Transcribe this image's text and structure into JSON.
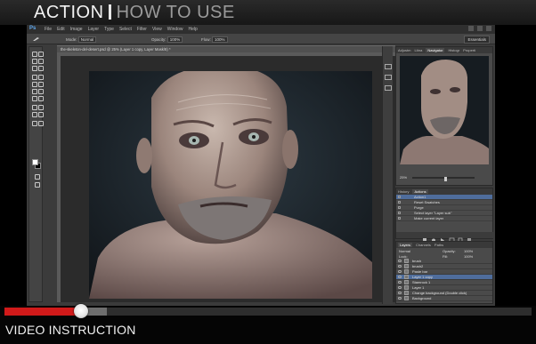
{
  "header": {
    "title_strong": "ACTION",
    "title_light": "HOW TO USE"
  },
  "photoshop": {
    "logo": "Ps",
    "menu": [
      "File",
      "Edit",
      "Image",
      "Layer",
      "Type",
      "Select",
      "Filter",
      "View",
      "Window",
      "Help"
    ],
    "options": {
      "mode_label": "Mode:",
      "mode_value": "Normal",
      "opacity_label": "Opacity:",
      "opacity_value": "100%",
      "flow_label": "Flow:",
      "flow_value": "100%"
    },
    "workspace": "Essentials",
    "document_tab": "the-skeleton-del-desert.psd @ 25% (Layer 1 copy, Layer Mask/8) *",
    "navigator_tabs": [
      "Adjustm",
      "Libra",
      "Navigator",
      "Histogr",
      "Properti"
    ],
    "navigator_zoom": "25%",
    "actions_tabs": [
      "History",
      "Actions"
    ],
    "actions": [
      {
        "label": "Action1",
        "selected": true
      },
      {
        "label": "Reset Swatches",
        "selected": false
      },
      {
        "label": "Purge",
        "selected": false
      },
      {
        "label": "Select layer \"Layer sub\"",
        "selected": false
      },
      {
        "label": "Make current layer",
        "selected": false
      }
    ],
    "layers_tabs": [
      "Layers",
      "Channels",
      "Paths"
    ],
    "layers_blend": "Normal",
    "layers_opacity_label": "Opacity:",
    "layers_opacity": "100%",
    "layers_lock_label": "Lock:",
    "layers_fill_label": "Fill:",
    "layers_fill": "100%",
    "layers": [
      {
        "label": "brush",
        "selected": false
      },
      {
        "label": "brush2",
        "selected": false
      },
      {
        "label": "Paste bar",
        "selected": false
      },
      {
        "label": "Layer 1 copy",
        "selected": true
      },
      {
        "label": "Stamrock 1",
        "selected": false
      },
      {
        "label": "Layer 1",
        "selected": false
      },
      {
        "label": "Change background (Double click)",
        "selected": false
      },
      {
        "label": "Background",
        "selected": false
      }
    ]
  },
  "player": {
    "progress": 0.145,
    "buffered": 0.195,
    "accent": "#d11a1a"
  },
  "caption": "VIDEO INSTRUCTION"
}
